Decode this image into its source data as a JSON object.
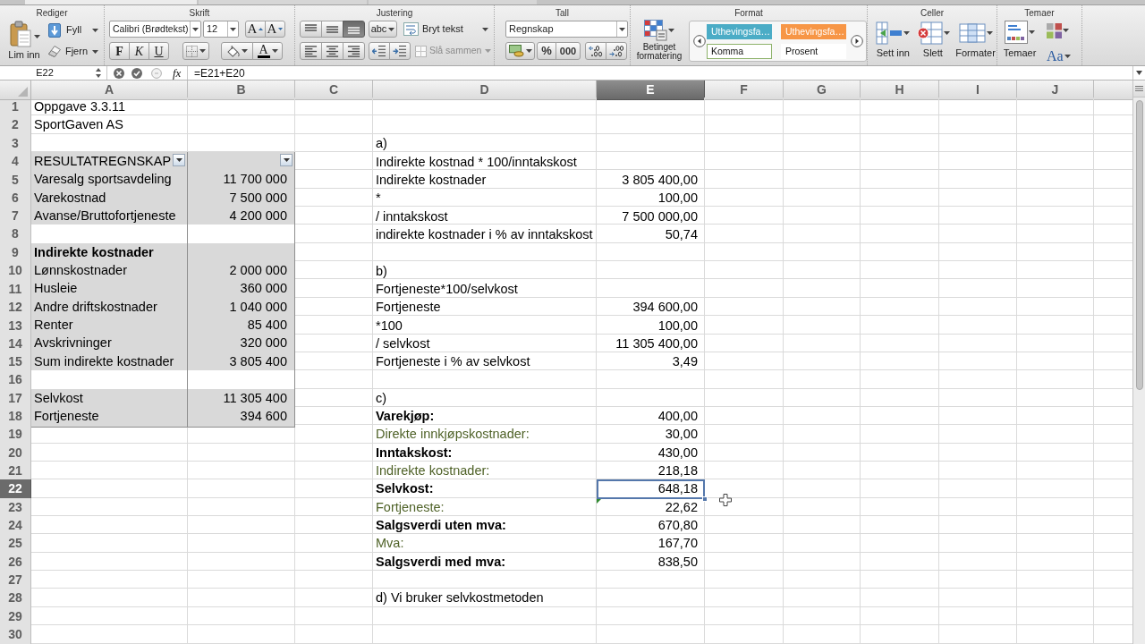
{
  "ribbon": {
    "edit": {
      "title": "Rediger",
      "paste": "Lim inn",
      "fill": "Fyll",
      "clear": "Fjern"
    },
    "font": {
      "title": "Skrift",
      "font_name": "Calibri (Brødtekst)",
      "font_size": "12",
      "grow": "A",
      "shrink": "A",
      "bold": "F",
      "italic": "K",
      "underline": "U",
      "font_color": "A"
    },
    "alignment": {
      "title": "Justering",
      "vertical": [
        {
          "kind": "top",
          "selected": false
        },
        {
          "kind": "middle",
          "selected": false
        },
        {
          "kind": "bottom",
          "selected": true
        }
      ],
      "orientation": "abc",
      "wrap": "Bryt tekst",
      "horizontal": [
        {
          "kind": "left",
          "selected": false
        },
        {
          "kind": "center",
          "selected": false
        },
        {
          "kind": "right",
          "selected": false
        }
      ],
      "merge": {
        "label": "Slå sammen",
        "disabled": true
      }
    },
    "number": {
      "title": "Tall",
      "format": "Regnskap",
      "percent": "%",
      "thousands": "000"
    },
    "format": {
      "title": "Format",
      "conditional": "Betinget formatering",
      "styles": [
        {
          "label": "Uthevingsfa…",
          "color": "#4bacc6",
          "selected": false
        },
        {
          "label": "Uthevingsfa…",
          "color": "#f79646",
          "selected": false
        },
        {
          "label": "Komma",
          "color": "#ffffff",
          "selected": true
        },
        {
          "label": "Prosent",
          "color": "#ffffff",
          "selected": false
        }
      ]
    },
    "cells": {
      "title": "Celler",
      "buttons": [
        {
          "kind": "insert",
          "label": "Sett inn"
        },
        {
          "kind": "delete",
          "label": "Slett"
        },
        {
          "kind": "format",
          "label": "Formater"
        }
      ]
    },
    "themes": {
      "title": "Temaer",
      "themes": "Temaer",
      "fonts": "Aa"
    }
  },
  "formula_bar": {
    "name_box": "E22",
    "function_label": "fx",
    "formula": "=E21+E20"
  },
  "sheet": {
    "columns": [
      {
        "label": "A",
        "selected": false
      },
      {
        "label": "B",
        "selected": false
      },
      {
        "label": "C",
        "selected": false
      },
      {
        "label": "D",
        "selected": false
      },
      {
        "label": "E",
        "selected": true
      },
      {
        "label": "F",
        "selected": false
      },
      {
        "label": "G",
        "selected": false
      },
      {
        "label": "H",
        "selected": false
      },
      {
        "label": "I",
        "selected": false
      },
      {
        "label": "J",
        "selected": false
      }
    ],
    "rows": [
      {
        "number": "1",
        "selected": false,
        "cells": [
          {
            "kind": "text",
            "text": "Oppgave 3.3.11"
          }
        ]
      },
      {
        "number": "2",
        "selected": false,
        "cells": [
          {
            "kind": "text",
            "text": "SportGaven AS"
          }
        ]
      },
      {
        "number": "3",
        "selected": false,
        "cells": [
          null,
          null,
          null,
          {
            "kind": "text",
            "text": "a)"
          }
        ]
      },
      {
        "number": "4",
        "selected": false,
        "cells": [
          {
            "kind": "table_header",
            "text": "RESULTATREGNSKAP"
          },
          {
            "kind": "table_header"
          },
          null,
          {
            "kind": "text",
            "text": "Indirekte kostnad * 100/inntakskost"
          }
        ]
      },
      {
        "number": "5",
        "selected": false,
        "cells": [
          {
            "kind": "table_label",
            "text": "Varesalg sportsavdeling"
          },
          {
            "kind": "table_number",
            "text": "11 700 000"
          },
          null,
          {
            "kind": "text",
            "text": "Indirekte kostnader"
          },
          {
            "kind": "number",
            "text": "3 805 400,00"
          }
        ]
      },
      {
        "number": "6",
        "selected": false,
        "cells": [
          {
            "kind": "table_label",
            "text": "Varekostnad"
          },
          {
            "kind": "table_number",
            "text": "7 500 000"
          },
          null,
          {
            "kind": "text",
            "text": "*"
          },
          {
            "kind": "number",
            "text": "100,00"
          }
        ]
      },
      {
        "number": "7",
        "selected": false,
        "cells": [
          {
            "kind": "table_label",
            "text": "Avanse/Bruttofortjeneste"
          },
          {
            "kind": "table_number",
            "text": "4 200 000"
          },
          null,
          {
            "kind": "text",
            "text": "/ inntakskost"
          },
          {
            "kind": "number",
            "text": "7 500 000,00"
          }
        ]
      },
      {
        "number": "8",
        "selected": false,
        "cells": [
          {
            "kind": "table_blank"
          },
          {
            "kind": "table_blank"
          },
          null,
          {
            "kind": "text",
            "text": "indirekte kostnader i % av inntakskost"
          },
          {
            "kind": "number",
            "text": "50,74"
          }
        ]
      },
      {
        "number": "9",
        "selected": false,
        "cells": [
          {
            "kind": "table_heading",
            "text": "Indirekte kostnader"
          },
          {
            "kind": "table_label"
          }
        ]
      },
      {
        "number": "10",
        "selected": false,
        "cells": [
          {
            "kind": "table_label",
            "text": "Lønnskostnader"
          },
          {
            "kind": "table_number",
            "text": "2 000 000"
          },
          null,
          {
            "kind": "text",
            "text": "b)"
          }
        ]
      },
      {
        "number": "11",
        "selected": false,
        "cells": [
          {
            "kind": "table_label",
            "text": "Husleie"
          },
          {
            "kind": "table_number",
            "text": "360 000"
          },
          null,
          {
            "kind": "text",
            "text": "Fortjeneste*100/selvkost"
          }
        ]
      },
      {
        "number": "12",
        "selected": false,
        "cells": [
          {
            "kind": "table_label",
            "text": "Andre driftskostnader"
          },
          {
            "kind": "table_number",
            "text": "1 040 000"
          },
          null,
          {
            "kind": "text",
            "text": "Fortjeneste"
          },
          {
            "kind": "number",
            "text": "394 600,00"
          }
        ]
      },
      {
        "number": "13",
        "selected": false,
        "cells": [
          {
            "kind": "table_label",
            "text": "Renter"
          },
          {
            "kind": "table_number",
            "text": "85 400"
          },
          null,
          {
            "kind": "text",
            "text": "*100"
          },
          {
            "kind": "number",
            "text": "100,00"
          }
        ]
      },
      {
        "number": "14",
        "selected": false,
        "cells": [
          {
            "kind": "table_label",
            "text": "Avskrivninger"
          },
          {
            "kind": "table_number",
            "text": "320 000"
          },
          null,
          {
            "kind": "text",
            "text": "/ selvkost"
          },
          {
            "kind": "number",
            "text": "11 305 400,00"
          }
        ]
      },
      {
        "number": "15",
        "selected": false,
        "cells": [
          {
            "kind": "table_label",
            "text": "Sum indirekte kostnader"
          },
          {
            "kind": "table_number",
            "text": "3 805 400"
          },
          null,
          {
            "kind": "text",
            "text": "Fortjeneste i % av selvkost"
          },
          {
            "kind": "number",
            "text": "3,49"
          }
        ]
      },
      {
        "number": "16",
        "selected": false,
        "cells": [
          {
            "kind": "table_blank"
          },
          {
            "kind": "table_blank"
          }
        ]
      },
      {
        "number": "17",
        "selected": false,
        "cells": [
          {
            "kind": "table_label",
            "text": "Selvkost"
          },
          {
            "kind": "table_number",
            "text": "11 305 400"
          },
          null,
          {
            "kind": "text",
            "text": "c)"
          }
        ]
      },
      {
        "number": "18",
        "selected": false,
        "cells": [
          {
            "kind": "table_label",
            "text": "Fortjeneste"
          },
          {
            "kind": "table_number",
            "text": "394 600"
          },
          null,
          {
            "kind": "total_label",
            "text": "Varekjøp:"
          },
          {
            "kind": "number",
            "text": "400,00"
          }
        ]
      },
      {
        "number": "19",
        "selected": false,
        "cells": [
          null,
          null,
          null,
          {
            "kind": "component_label",
            "text": "Direkte innkjøpskostnader:"
          },
          {
            "kind": "number",
            "text": "30,00"
          }
        ]
      },
      {
        "number": "20",
        "selected": false,
        "cells": [
          null,
          null,
          null,
          {
            "kind": "total_label",
            "text": "Inntakskost:"
          },
          {
            "kind": "number",
            "text": "430,00"
          }
        ]
      },
      {
        "number": "21",
        "selected": false,
        "cells": [
          null,
          null,
          null,
          {
            "kind": "component_label",
            "text": "Indirekte kostnader:"
          },
          {
            "kind": "number",
            "text": "218,18"
          }
        ]
      },
      {
        "number": "22",
        "selected": true,
        "cells": [
          null,
          null,
          null,
          {
            "kind": "total_label",
            "text": "Selvkost:"
          },
          {
            "kind": "number",
            "text": "648,18"
          }
        ]
      },
      {
        "number": "23",
        "selected": false,
        "cells": [
          null,
          null,
          null,
          {
            "kind": "component_label",
            "text": "Fortjeneste:"
          },
          {
            "kind": "number",
            "text": "22,62",
            "flagged": true
          }
        ]
      },
      {
        "number": "24",
        "selected": false,
        "cells": [
          null,
          null,
          null,
          {
            "kind": "total_label",
            "text": "Salgsverdi uten mva:"
          },
          {
            "kind": "number",
            "text": "670,80"
          }
        ]
      },
      {
        "number": "25",
        "selected": false,
        "cells": [
          null,
          null,
          null,
          {
            "kind": "component_label",
            "text": "Mva:"
          },
          {
            "kind": "number",
            "text": "167,70"
          }
        ]
      },
      {
        "number": "26",
        "selected": false,
        "cells": [
          null,
          null,
          null,
          {
            "kind": "total_label",
            "text": "Salgsverdi med mva:"
          },
          {
            "kind": "number",
            "text": "838,50"
          }
        ]
      },
      {
        "number": "27",
        "selected": false
      },
      {
        "number": "28",
        "selected": false,
        "cells": [
          null,
          null,
          null,
          {
            "kind": "text",
            "text": "d) Vi bruker selvkostmetoden"
          }
        ]
      },
      {
        "number": "29",
        "selected": false
      },
      {
        "number": "30",
        "selected": false
      }
    ]
  }
}
